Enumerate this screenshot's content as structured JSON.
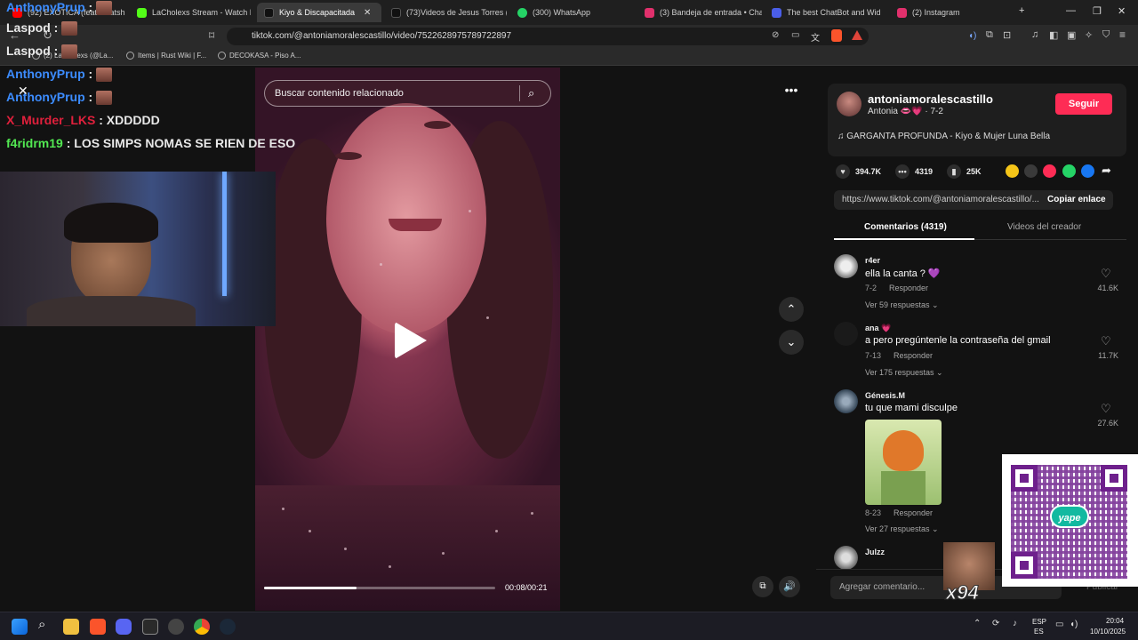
{
  "browser": {
    "tabs": [
      {
        "title": "(92) EXÓTICA (feat. chatsheler",
        "color": "#ff0000"
      },
      {
        "title": "LaCholexs Stream - Watch Live",
        "color": "#53fc18"
      },
      {
        "title": "Kiyo & Discapacitada",
        "color": "#000000",
        "active": true
      },
      {
        "title": "(73)Videos de Jesus Torres (@",
        "color": "#000000"
      },
      {
        "title": "(300) WhatsApp",
        "color": "#25d366"
      },
      {
        "title": "(3) Bandeja de entrada • Chats",
        "color": "#e1306c"
      },
      {
        "title": "The best ChatBot and Wid",
        "color": "#4a5ee8"
      },
      {
        "title": "(2) Instagram",
        "color": "#e1306c"
      }
    ],
    "new_tab": "+",
    "url": "tiktok.com/@antoniamoralescastillo/video/7522628975789722897",
    "bookmarks": [
      "(2) LaCholexs (@La...",
      "Items | Rust Wiki | F...",
      "DECOKASA - Piso A..."
    ]
  },
  "stream_chat": [
    {
      "user": "AnthonyPrup",
      "sep": " :",
      "text": "",
      "color": "#3c8cff"
    },
    {
      "user": "Laspod",
      "sep": " :",
      "text": "",
      "color": "#ffffff"
    },
    {
      "user": "Laspod",
      "sep": " :",
      "text": "",
      "color": "#ffffff"
    },
    {
      "user": "AnthonyPrup",
      "sep": " :",
      "text": "",
      "color": "#3c8cff"
    },
    {
      "user": "AnthonyPrup",
      "sep": " :",
      "text": "",
      "color": "#3c8cff"
    },
    {
      "user": "X_Murder_LKS",
      "sep": " :",
      "text": " XDDDDD",
      "color": "#e0203c"
    },
    {
      "user": "f4ridrm19",
      "sep": " :",
      "text": " LOS SIMPS NOMAS SE RIEN DE ESO",
      "color": "#52e852"
    }
  ],
  "video": {
    "search_placeholder": "Buscar contenido relacionado",
    "time": "00:08/00:21",
    "progress": 0.4
  },
  "creator": {
    "username": "antoniamoralescastillo",
    "display_name": "Antonia 👄💗 · 7-2",
    "follow_label": "Seguir",
    "music": "♫  GARGANTA PROFUNDA - Kiyo & Mujer Luna Bella",
    "likes": "394.7K",
    "comments": "4319",
    "saves": "25K",
    "link": "https://www.tiktok.com/@antoniamoralescastillo/...",
    "copy_label": "Copiar enlace"
  },
  "tabs": {
    "comments": "Comentarios (4319)",
    "creator_videos": "Videos del creador"
  },
  "comments": [
    {
      "user": "r4er",
      "text": "ella la canta ? 💜",
      "date": "7-2",
      "reply": "Responder",
      "more": "Ver 59 respuestas ⌄",
      "likes": "41.6K"
    },
    {
      "user": "ana 💗",
      "text": "a pero pregúntenle la contraseña del gmail",
      "date": "7-13",
      "reply": "Responder",
      "more": "Ver 175 respuestas ⌄",
      "likes": "11.7K"
    },
    {
      "user": "Génesis.M",
      "text": "tu que mami disculpe",
      "date": "8-23",
      "reply": "Responder",
      "more": "Ver 27 respuestas ⌄",
      "likes": "27.6K"
    },
    {
      "user": "Julzz",
      "text": "",
      "date": "",
      "reply": "",
      "more": "",
      "likes": ""
    }
  ],
  "comment_input_placeholder": "Agregar comentario...",
  "publish_label": "Publicar",
  "overlay": {
    "yape": "yape",
    "counter": "x94"
  },
  "taskbar": {
    "lang1": "ESP",
    "lang2": "ES",
    "time": "20:04",
    "date": "10/10/2025"
  }
}
